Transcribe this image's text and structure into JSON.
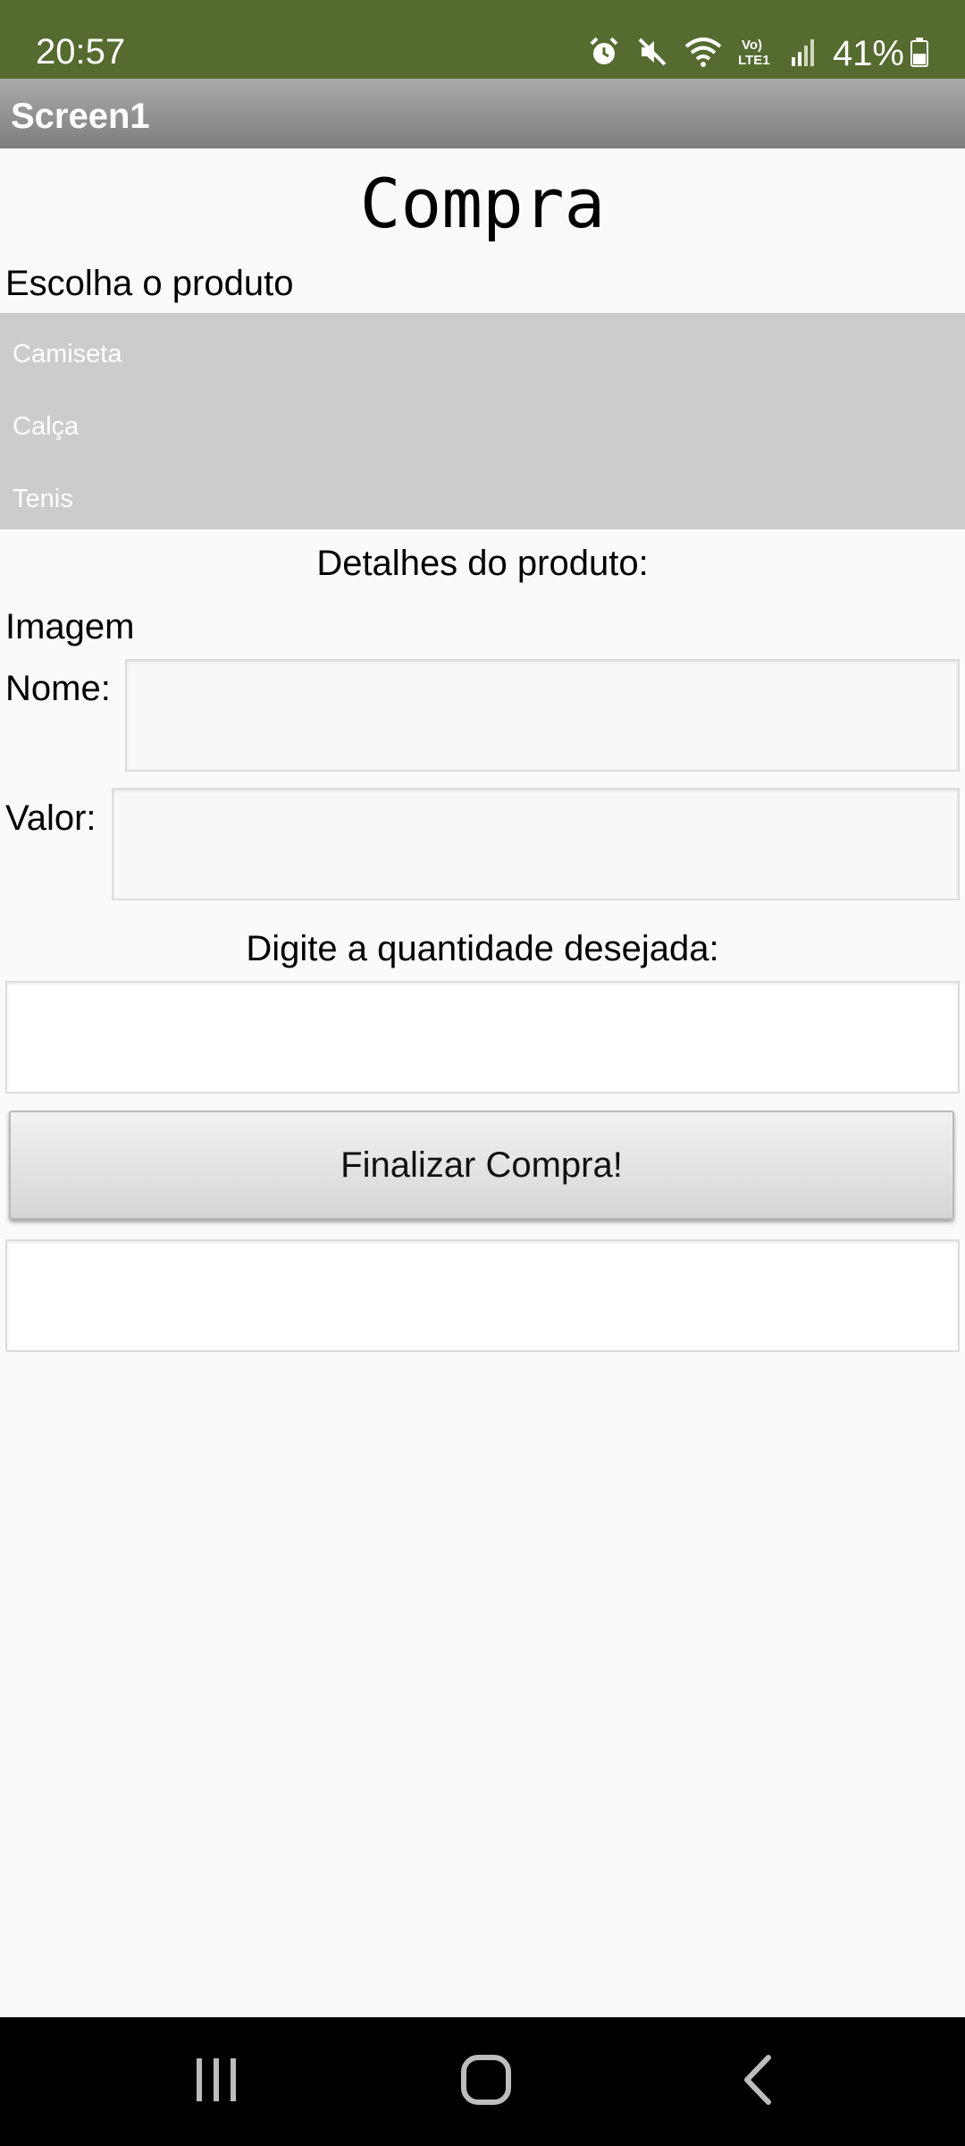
{
  "status_bar": {
    "time": "20:57",
    "battery": "41%",
    "network_label": "Vo) LTE1",
    "icons": [
      "alarm-icon",
      "mute-icon",
      "wifi-icon",
      "volte-icon",
      "signal-icon",
      "battery-icon"
    ],
    "background_color": "#556b2f"
  },
  "title_bar": {
    "title": "Screen1"
  },
  "form": {
    "heading": "Compra",
    "choose_label": "Escolha o produto",
    "products": [
      "Camiseta",
      "Calça",
      "Tenis"
    ],
    "details_label": "Detalhes do produto:",
    "image_label": "Imagem",
    "name_label": "Nome:",
    "name_value": "",
    "value_label": "Valor:",
    "value_value": "",
    "quantity_label": "Digite a quantidade desejada:",
    "quantity_value": "",
    "finish_button": "Finalizar Compra!",
    "result_value": ""
  },
  "nav_bar": {
    "icons": [
      "recent-apps-icon",
      "home-icon",
      "back-icon"
    ]
  }
}
